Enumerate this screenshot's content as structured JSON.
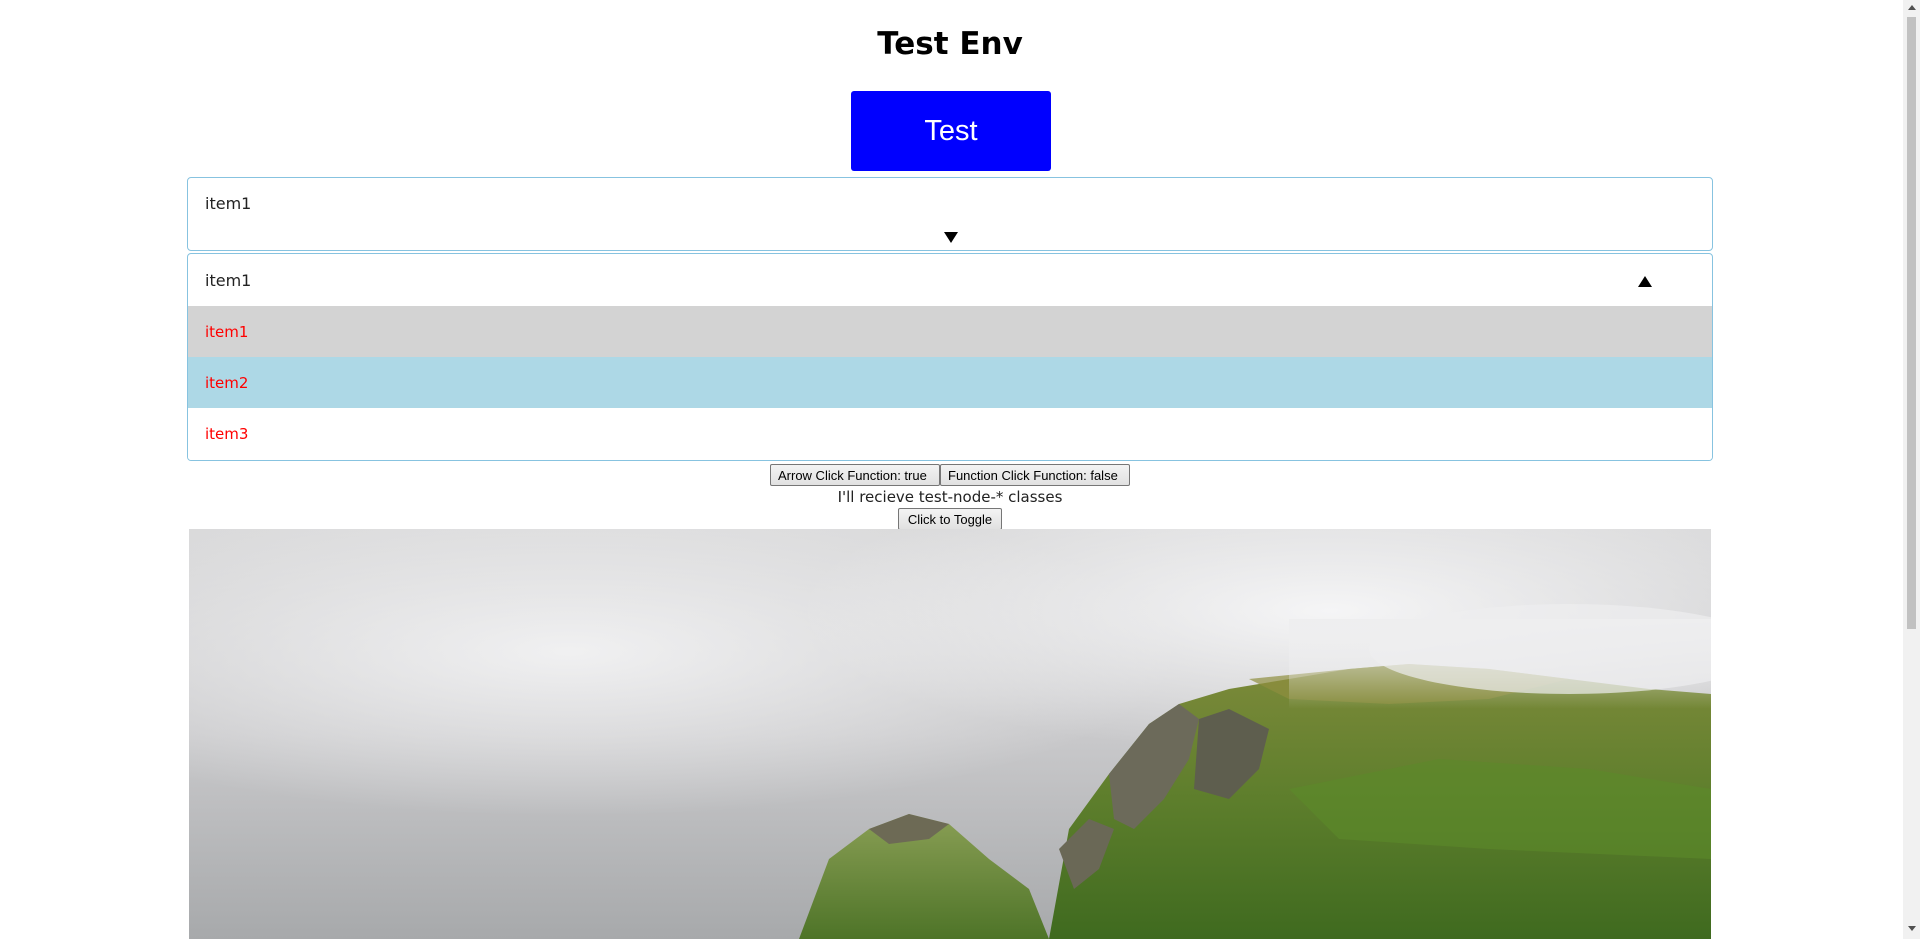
{
  "page": {
    "title": "Test Env"
  },
  "test_button": {
    "label": "Test",
    "color": "#0000ff"
  },
  "select_closed": {
    "value": "item1",
    "arrow_icon": "triangle-down-icon"
  },
  "select_open": {
    "value": "item1",
    "arrow_icon": "triangle-up-icon",
    "options": [
      {
        "label": "item1",
        "state": "selected",
        "bg": "#d3d3d3"
      },
      {
        "label": "item2",
        "state": "hovered",
        "bg": "#add8e6"
      },
      {
        "label": "item3",
        "state": "normal",
        "bg": "#ffffff"
      }
    ],
    "option_text_color": "#ff0000"
  },
  "controls": {
    "arrow_click_label": "Arrow Click Function: true",
    "function_click_label": "Function Click Function: false",
    "info_text": "I'll recieve test-node-* classes",
    "toggle_label": "Click to Toggle"
  },
  "image": {
    "subject": "landscape-photo"
  }
}
